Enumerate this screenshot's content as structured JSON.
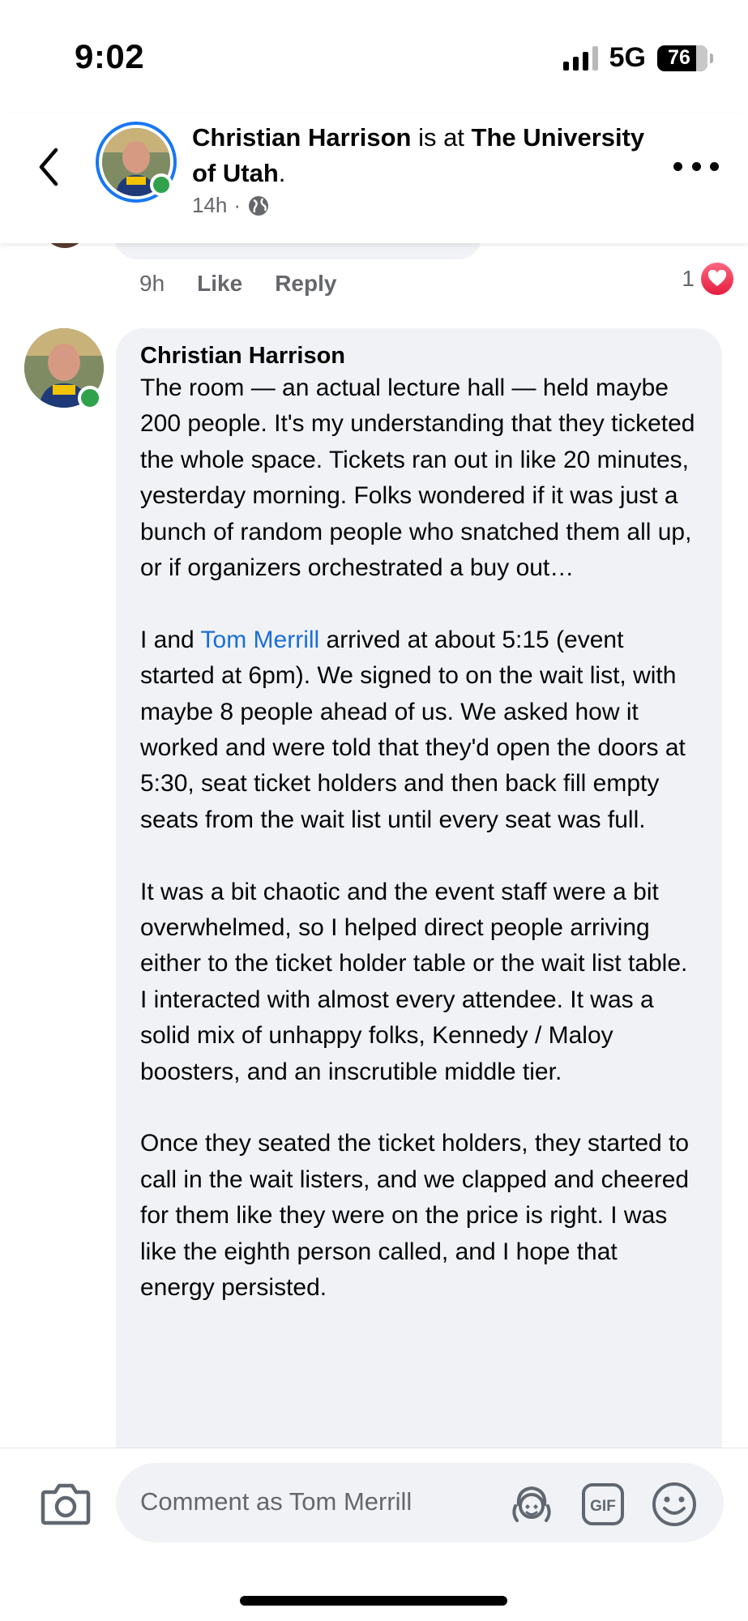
{
  "status_bar": {
    "time": "9:02",
    "network": "5G",
    "battery": "76"
  },
  "header": {
    "author": "Christian Harrison",
    "connector": " is at ",
    "location": "The University of Utah",
    "suffix": ".",
    "time": "14h",
    "separator": "·",
    "icons": {
      "back": "chevron-left-icon",
      "privacy": "globe-icon",
      "more": "more-horizontal-icon"
    }
  },
  "previous_comment": {
    "time": "9h",
    "like_label": "Like",
    "reply_label": "Reply",
    "reaction_count": "1",
    "reaction_icon": "heart-icon"
  },
  "comment": {
    "author": "Christian Harrison",
    "paragraphs": [
      "The room — an actual lecture hall — held maybe 200 people. It's my understanding that they ticketed the whole space. Tickets ran out in like 20 minutes, yesterday morning. Folks wondered if it was just a bunch of random people who snatched them all up, or if organizers orchestrated a buy out…",
      "",
      "It was a bit chaotic and the event staff were a bit overwhelmed, so I helped direct people arriving either to the ticket holder table or the wait list table. I interacted with almost every attendee. It was a solid mix of unhappy folks, Kennedy / Maloy boosters, and an inscrutible middle tier.",
      "Once they seated the ticket holders, they started to call in the wait listers, and we clapped and cheered for them like they were on the price is right. I was like the eighth person called, and I hope that energy persisted."
    ],
    "para2_before": "I and ",
    "para2_mention": "Tom Merrill",
    "para2_after": " arrived at about 5:15 (event started at 6pm). We signed to on the wait list, with maybe 8 people ahead of us. We asked how it worked and were told that they'd open the doors at 5:30, seat ticket holders and then back fill empty seats from the wait list until every seat was full."
  },
  "composer": {
    "placeholder": "Comment as Tom Merrill",
    "icons": [
      "camera-icon",
      "avatar-sticker-icon",
      "gif-icon",
      "emoji-icon"
    ],
    "gif_label": "GIF"
  },
  "colors": {
    "accent": "#1877f2",
    "mention": "#1a6ed8",
    "online": "#31a24c",
    "bubble": "#f0f2f5",
    "secondary_text": "#65676b",
    "heart": "#e41e3f"
  }
}
